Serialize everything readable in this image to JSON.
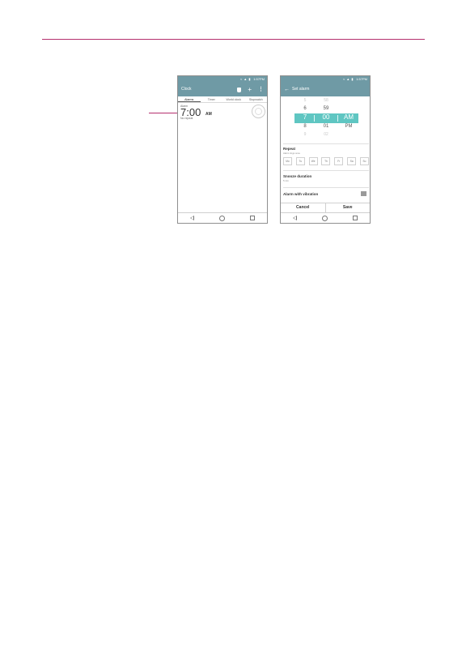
{
  "status_bar": {
    "time": "1:57PM"
  },
  "clock_screen": {
    "title": "Clock",
    "tabs": [
      "Alarms",
      "Timer",
      "World clock",
      "Stopwatch"
    ],
    "active_tab": "Alarms",
    "alarm": {
      "label": "Alarm",
      "time": "7:00",
      "ampm": "AM",
      "repeat": "No repeat",
      "enabled": false
    }
  },
  "set_alarm_screen": {
    "title": "Set alarm",
    "picker": {
      "hours": [
        "5",
        "6",
        "7",
        "8",
        "9"
      ],
      "minutes": [
        "58",
        "59",
        "00",
        "01",
        "02"
      ],
      "ampm": [
        "",
        "",
        "AM",
        "PM",
        ""
      ],
      "selected_index": 2
    },
    "repeat": {
      "title": "Repeat",
      "subtitle": "Alarm rings once",
      "days": [
        "Mo",
        "Tu",
        "We",
        "Th",
        "Fr",
        "Sa",
        "Su"
      ]
    },
    "snooze": {
      "title": "Snooze duration",
      "value": "5 min"
    },
    "vibration": {
      "title": "Alarm with vibration",
      "checked": true
    },
    "buttons": {
      "cancel": "Cancel",
      "save": "Save"
    }
  },
  "colors": {
    "app_bar": "#6f9aa5",
    "picker_highlight": "#5fc6c2",
    "rule": "#b5306e"
  }
}
